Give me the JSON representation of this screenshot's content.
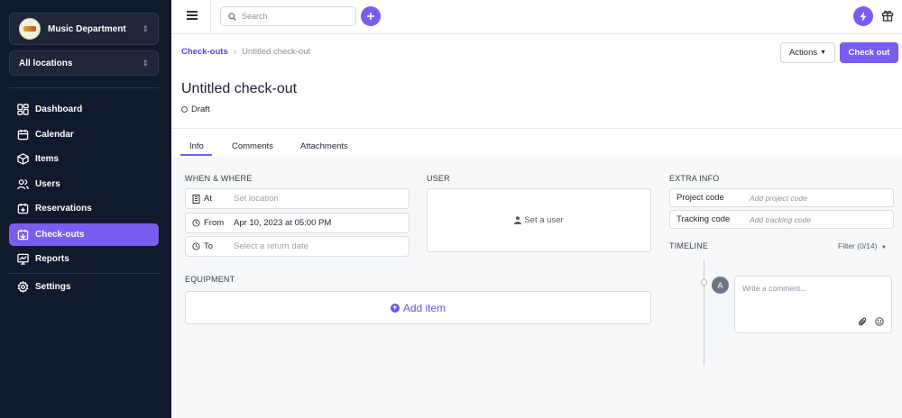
{
  "sidebar": {
    "org_name": "Music Department",
    "location": "All locations",
    "items": [
      {
        "label": "Dashboard",
        "icon": "dashboard-icon"
      },
      {
        "label": "Calendar",
        "icon": "calendar-icon"
      },
      {
        "label": "Items",
        "icon": "box-icon"
      },
      {
        "label": "Users",
        "icon": "users-icon"
      },
      {
        "label": "Reservations",
        "icon": "reservations-icon"
      },
      {
        "label": "Check-outs",
        "icon": "checkout-icon",
        "active": true
      },
      {
        "label": "Reports",
        "icon": "reports-icon"
      },
      {
        "label": "Settings",
        "icon": "settings-icon"
      }
    ]
  },
  "topbar": {
    "search_placeholder": "Search"
  },
  "breadcrumb": {
    "parent": "Check-outs",
    "separator": ">",
    "current": "Untitled check-out"
  },
  "header": {
    "actions_label": "Actions",
    "checkout_label": "Check out",
    "title": "Untitled check-out",
    "status": "Draft"
  },
  "tabs": [
    "Info",
    "Comments",
    "Attachments"
  ],
  "when_where": {
    "heading": "WHEN & WHERE",
    "at_label": "At",
    "at_value": "Set location",
    "from_label": "From",
    "from_value": "Apr 10, 2023 at 05:00 PM",
    "to_label": "To",
    "to_value": "Select a return date"
  },
  "user": {
    "heading": "USER",
    "set_user": "Set a user"
  },
  "equipment": {
    "heading": "EQUIPMENT",
    "add_item": "Add item"
  },
  "extra_info": {
    "heading": "EXTRA INFO",
    "project_label": "Project code",
    "project_placeholder": "Add project code",
    "tracking_label": "Tracking code",
    "tracking_placeholder": "Add tracking code"
  },
  "timeline": {
    "heading": "TIMELINE",
    "filter": "Filter (0/14)",
    "avatar_initial": "A",
    "comment_placeholder": "Write a comment..."
  },
  "colors": {
    "accent": "#7a5cf0",
    "sidebar_bg": "#111a2c"
  }
}
